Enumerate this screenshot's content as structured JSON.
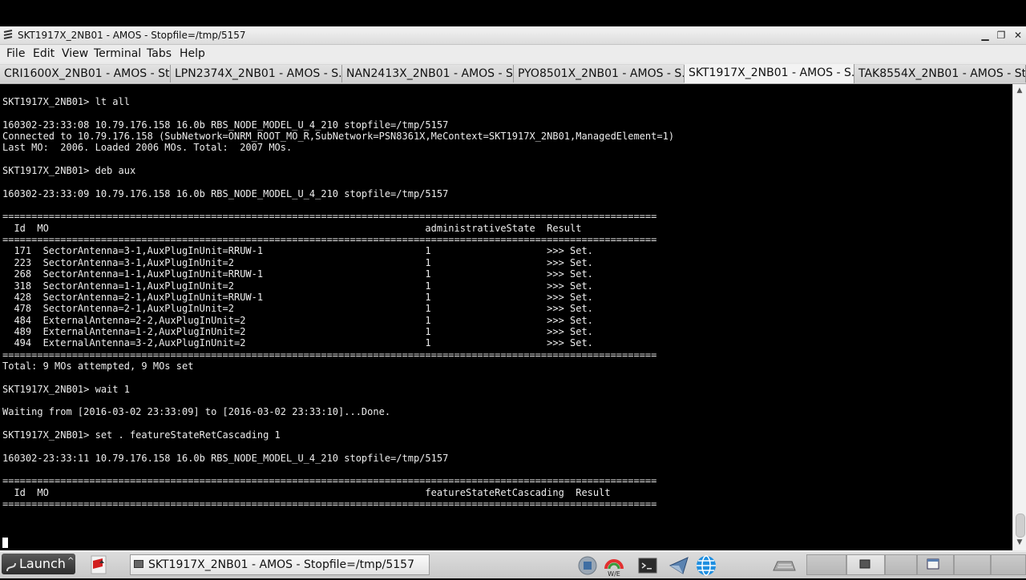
{
  "window": {
    "title": "SKT1917X_2NB01 - AMOS - Stopfile=/tmp/5157",
    "controls": {
      "minimize": "▁",
      "maximize": "❐",
      "close": "✕"
    }
  },
  "menu": [
    {
      "label": "File"
    },
    {
      "label": "Edit"
    },
    {
      "label": "View"
    },
    {
      "label": "Terminal"
    },
    {
      "label": "Tabs"
    },
    {
      "label": "Help"
    }
  ],
  "tabs": [
    {
      "label": "CRI1600X_2NB01 - AMOS - St..."
    },
    {
      "label": "LPN2374X_2NB01 - AMOS - S..."
    },
    {
      "label": "NAN2413X_2NB01 - AMOS - S..."
    },
    {
      "label": "PYO8501X_2NB01 - AMOS - S..."
    },
    {
      "label": "SKT1917X_2NB01 - AMOS - S..."
    },
    {
      "label": "TAK8554X_2NB01 - AMOS - St..."
    }
  ],
  "terminal": {
    "lines": [
      "SKT1917X_2NB01> lt all",
      "",
      "160302-23:33:08 10.79.176.158 16.0b RBS_NODE_MODEL_U_4_210 stopfile=/tmp/5157",
      "Connected to 10.79.176.158 (SubNetwork=ONRM_ROOT_MO_R,SubNetwork=PSN8361X,MeContext=SKT1917X_2NB01,ManagedElement=1)",
      "Last MO:  2006. Loaded 2006 MOs. Total:  2007 MOs.",
      "",
      "SKT1917X_2NB01> deb aux",
      "",
      "160302-23:33:09 10.79.176.158 16.0b RBS_NODE_MODEL_U_4_210 stopfile=/tmp/5157",
      "",
      "=================================================================================================================",
      "  Id  MO                                                                 administrativeState  Result",
      "=================================================================================================================",
      "  171  SectorAntenna=3-1,AuxPlugInUnit=RRUW-1                            1                    >>> Set.",
      "  223  SectorAntenna=3-1,AuxPlugInUnit=2                                 1                    >>> Set.",
      "  268  SectorAntenna=1-1,AuxPlugInUnit=RRUW-1                            1                    >>> Set.",
      "  318  SectorAntenna=1-1,AuxPlugInUnit=2                                 1                    >>> Set.",
      "  428  SectorAntenna=2-1,AuxPlugInUnit=RRUW-1                            1                    >>> Set.",
      "  478  SectorAntenna=2-1,AuxPlugInUnit=2                                 1                    >>> Set.",
      "  484  ExternalAntenna=2-2,AuxPlugInUnit=2                               1                    >>> Set.",
      "  489  ExternalAntenna=1-2,AuxPlugInUnit=2                               1                    >>> Set.",
      "  494  ExternalAntenna=3-2,AuxPlugInUnit=2                               1                    >>> Set.",
      "=================================================================================================================",
      "Total: 9 MOs attempted, 9 MOs set",
      "",
      "SKT1917X_2NB01> wait 1",
      "",
      "Waiting from [2016-03-02 23:33:09] to [2016-03-02 23:33:10]...Done.",
      "",
      "SKT1917X_2NB01> set . featureStateRetCascading 1",
      "",
      "160302-23:33:11 10.79.176.158 16.0b RBS_NODE_MODEL_U_4_210 stopfile=/tmp/5157",
      "",
      "=================================================================================================================",
      "  Id  MO                                                                 featureStateRetCascading  Result",
      "================================================================================================================="
    ]
  },
  "taskbar": {
    "launch_label": "Launch",
    "task_label": "SKT1917X_2NB01 - AMOS - Stopfile=/tmp/5157",
    "weather_text": "W/E"
  }
}
